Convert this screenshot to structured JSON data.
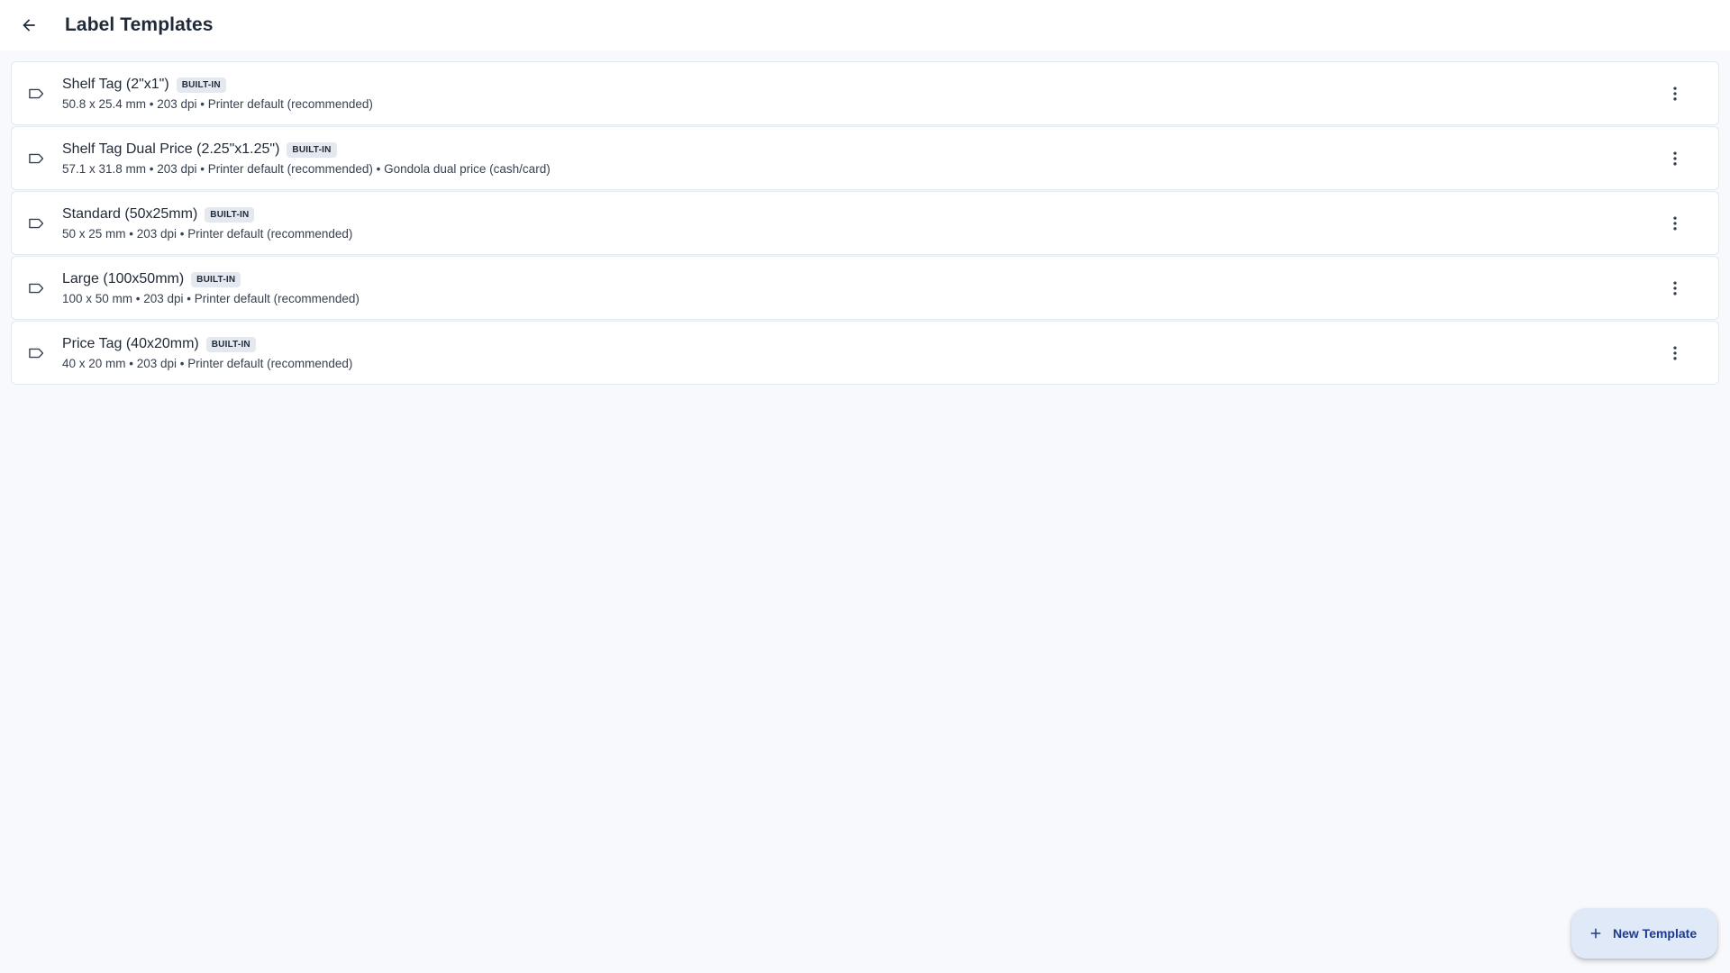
{
  "header": {
    "title": "Label Templates",
    "back_icon": "arrow-back-icon"
  },
  "templates": [
    {
      "title": "Shelf Tag (2\"x1\")",
      "badge": "BUILT-IN",
      "subtitle": "50.8 x 25.4 mm • 203 dpi • Printer default (recommended)"
    },
    {
      "title": "Shelf Tag Dual Price (2.25\"x1.25\")",
      "badge": "BUILT-IN",
      "subtitle": "57.1 x 31.8 mm • 203 dpi • Printer default (recommended) • Gondola dual price (cash/card)"
    },
    {
      "title": "Standard (50x25mm)",
      "badge": "BUILT-IN",
      "subtitle": "50 x 25 mm • 203 dpi • Printer default (recommended)"
    },
    {
      "title": "Large (100x50mm)",
      "badge": "BUILT-IN",
      "subtitle": "100 x 50 mm • 203 dpi • Printer default (recommended)"
    },
    {
      "title": "Price Tag (40x20mm)",
      "badge": "BUILT-IN",
      "subtitle": "40 x 20 mm • 203 dpi • Printer default (recommended)"
    }
  ],
  "fab": {
    "label": "New Template",
    "icon": "plus-icon"
  },
  "colors": {
    "background": "#f7f9fc",
    "fab_background": "#e0e9f7",
    "fab_text": "#1e3a8a",
    "badge_background": "#e5e9ef"
  }
}
